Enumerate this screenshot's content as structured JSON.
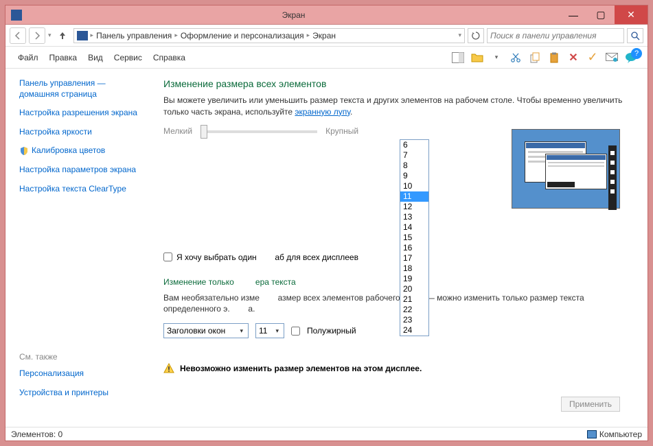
{
  "title": "Экран",
  "breadcrumb": {
    "p1": "Панель управления",
    "p2": "Оформление и персонализация",
    "p3": "Экран"
  },
  "search": {
    "placeholder": "Поиск в панели управления"
  },
  "menu": {
    "file": "Файл",
    "edit": "Правка",
    "view": "Вид",
    "tools": "Сервис",
    "help": "Справка"
  },
  "sidebar": {
    "home": "Панель управления — домашняя страница",
    "links": [
      "Настройка разрешения экрана",
      "Настройка яркости",
      "Калибровка цветов",
      "Настройка параметров экрана",
      "Настройка текста ClearType"
    ],
    "seealso_head": "См. также",
    "seealso": [
      "Персонализация",
      "Устройства и принтеры"
    ]
  },
  "content": {
    "h1": "Изменение размера всех элементов",
    "desc_a": "Вы можете увеличить или уменьшить размер текста и других элементов на рабочем столе. Чтобы временно увеличить только часть экрана, используйте ",
    "desc_link": "экранную лупу",
    "desc_b": ".",
    "slider_min": "Мелкий",
    "slider_max": "Крупный",
    "chk_label_a": "Я хочу выбрать один",
    "chk_label_b": "аб для всех дисплеев",
    "h1b_a": "Изменение только",
    "h1b_b": "ера текста",
    "desc2_a": "Вам необязательно изме",
    "desc2_b": "азмер всех элементов рабочего стола — можно изменить только размер текста определенного э.",
    "desc2_c": "а.",
    "combo1": "Заголовки окон",
    "combo2": "11",
    "bold_label": "Полужирный",
    "warning": "Невозможно изменить размер элементов на этом дисплее.",
    "apply": "Применить"
  },
  "dropdown": {
    "options": [
      "6",
      "7",
      "8",
      "9",
      "10",
      "11",
      "12",
      "13",
      "14",
      "15",
      "16",
      "17",
      "18",
      "19",
      "20",
      "21",
      "22",
      "23",
      "24"
    ],
    "selected": "11"
  },
  "statusbar": {
    "left": "Элементов: 0",
    "right": "Компьютер"
  }
}
